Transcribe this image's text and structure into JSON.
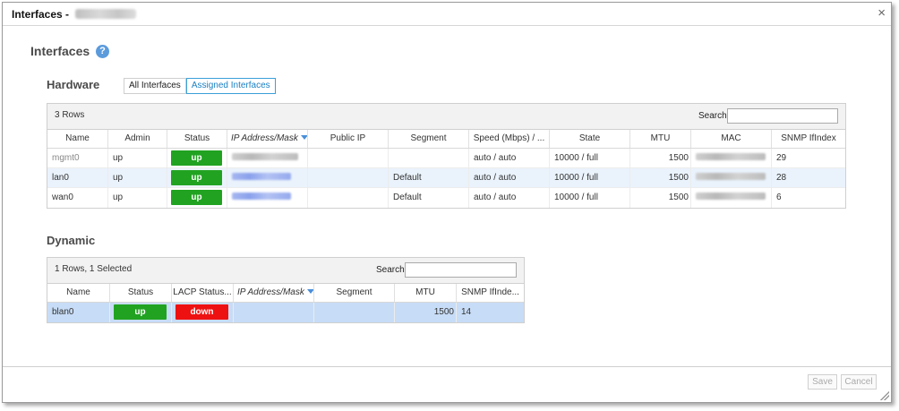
{
  "window": {
    "title": "Interfaces - ",
    "close_glyph": "×"
  },
  "page": {
    "title": "Interfaces",
    "help_glyph": "?"
  },
  "hardware": {
    "title": "Hardware",
    "filters": [
      "All Interfaces",
      "Assigned Interfaces"
    ],
    "active_filter": "Assigned Interfaces",
    "row_count": "3 Rows",
    "search_label": "Search",
    "columns": [
      "Name",
      "Admin",
      "Status",
      "IP Address/Mask",
      "Public IP",
      "Segment",
      "Speed (Mbps) / ...",
      "State",
      "MTU",
      "MAC",
      "SNMP IfIndex"
    ],
    "rows": [
      {
        "name": "mgmt0",
        "admin": "up",
        "status": "up",
        "public_ip": "",
        "segment": "",
        "speed": "auto / auto",
        "state": "10000 / full",
        "mtu": "1500",
        "snmp": "29"
      },
      {
        "name": "lan0",
        "admin": "up",
        "status": "up",
        "public_ip": "",
        "segment": "Default",
        "speed": "auto / auto",
        "state": "10000 / full",
        "mtu": "1500",
        "snmp": "28"
      },
      {
        "name": "wan0",
        "admin": "up",
        "status": "up",
        "public_ip": "",
        "segment": "Default",
        "speed": "auto / auto",
        "state": "10000 / full",
        "mtu": "1500",
        "snmp": "6"
      }
    ]
  },
  "dynamic": {
    "title": "Dynamic",
    "row_count": "1 Rows, 1 Selected",
    "search_label": "Search",
    "columns": [
      "Name",
      "Status",
      "LACP Status...",
      "IP Address/Mask",
      "Segment",
      "MTU",
      "SNMP IfInde..."
    ],
    "rows": [
      {
        "name": "blan0",
        "status": "up",
        "lacp": "down",
        "segment": "",
        "mtu": "1500",
        "snmp": "14"
      }
    ]
  },
  "footer": {
    "save_label": "Save",
    "cancel_label": "Cancel"
  },
  "colors": {
    "status_up": "#21a321",
    "status_down": "#ee1111",
    "accent": "#3aa0d8",
    "help_icon": "#5b9bdc"
  }
}
